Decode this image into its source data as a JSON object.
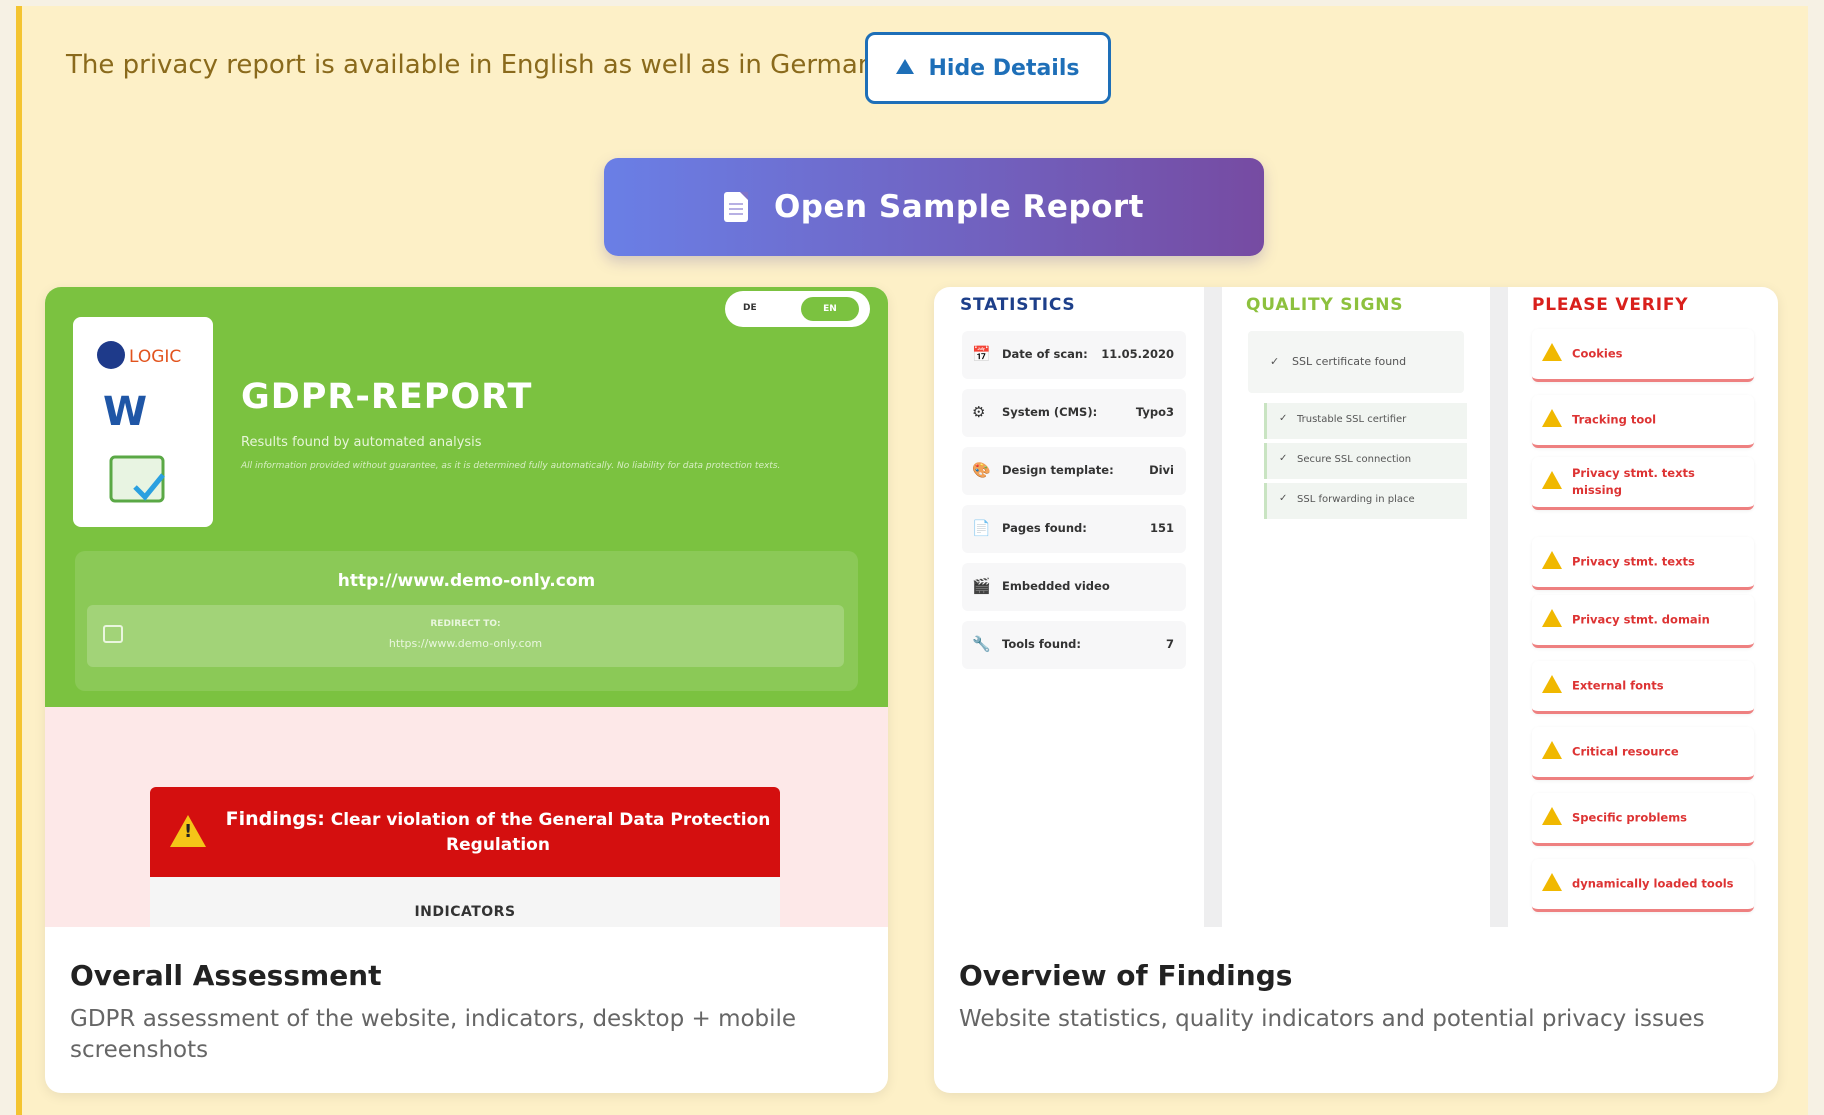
{
  "intro_text": "The privacy report is available in English as well as in German.",
  "hide_details_label": "Hide Details",
  "open_sample_label": "Open Sample Report",
  "colors": {
    "accent_blue": "#1e6fb8",
    "gradient_start": "#6a7fe6",
    "gradient_end": "#764ba2",
    "report_green": "#7bc240",
    "findings_red": "#d40f0f"
  },
  "left_card": {
    "title": "Overall Assessment",
    "description": "GDPR assessment of the website, indicators, desktop + mobile screenshots",
    "preview": {
      "logo_text": "LOGIC",
      "lang_de": "DE",
      "lang_en": "EN",
      "report_title": "GDPR-REPORT",
      "report_subtitle": "Results found by automated analysis",
      "report_note": "All information provided without guarantee, as it is determined fully automatically. No liability for data protection texts.",
      "url": "http://www.demo-only.com",
      "redirect_label": "REDIRECT TO:",
      "redirect_url": "https://www.demo-only.com",
      "findings_label": "Findings:",
      "findings_text": "Clear violation of the General Data Protection Regulation",
      "indicators_label": "INDICATORS"
    }
  },
  "right_card": {
    "title": "Overview of Findings",
    "description": "Website statistics, quality indicators and potential privacy issues",
    "statistics_head": "STATISTICS",
    "quality_head": "QUALITY SIGNS",
    "verify_head": "PLEASE VERIFY",
    "stats": [
      {
        "icon": "calendar-icon",
        "key": "Date of scan:",
        "value": "11.05.2020"
      },
      {
        "icon": "gear-icon",
        "key": "System (CMS):",
        "value": "Typo3"
      },
      {
        "icon": "palette-icon",
        "key": "Design template:",
        "value": "Divi"
      },
      {
        "icon": "page-icon",
        "key": "Pages found:",
        "value": "151"
      },
      {
        "icon": "film-icon",
        "key": "Embedded video",
        "value": ""
      },
      {
        "icon": "wrench-icon",
        "key": "Tools found:",
        "value": "7"
      }
    ],
    "quality_main": "SSL certificate found",
    "quality_items": [
      "Trustable SSL certifier",
      "Secure SSL connection",
      "SSL forwarding in place"
    ],
    "verify_items": [
      "Cookies",
      "Tracking tool",
      "Privacy stmt. texts missing",
      "Privacy stmt. texts",
      "Privacy stmt. domain",
      "External fonts",
      "Critical resource",
      "Specific problems",
      "dynamically loaded tools"
    ]
  }
}
